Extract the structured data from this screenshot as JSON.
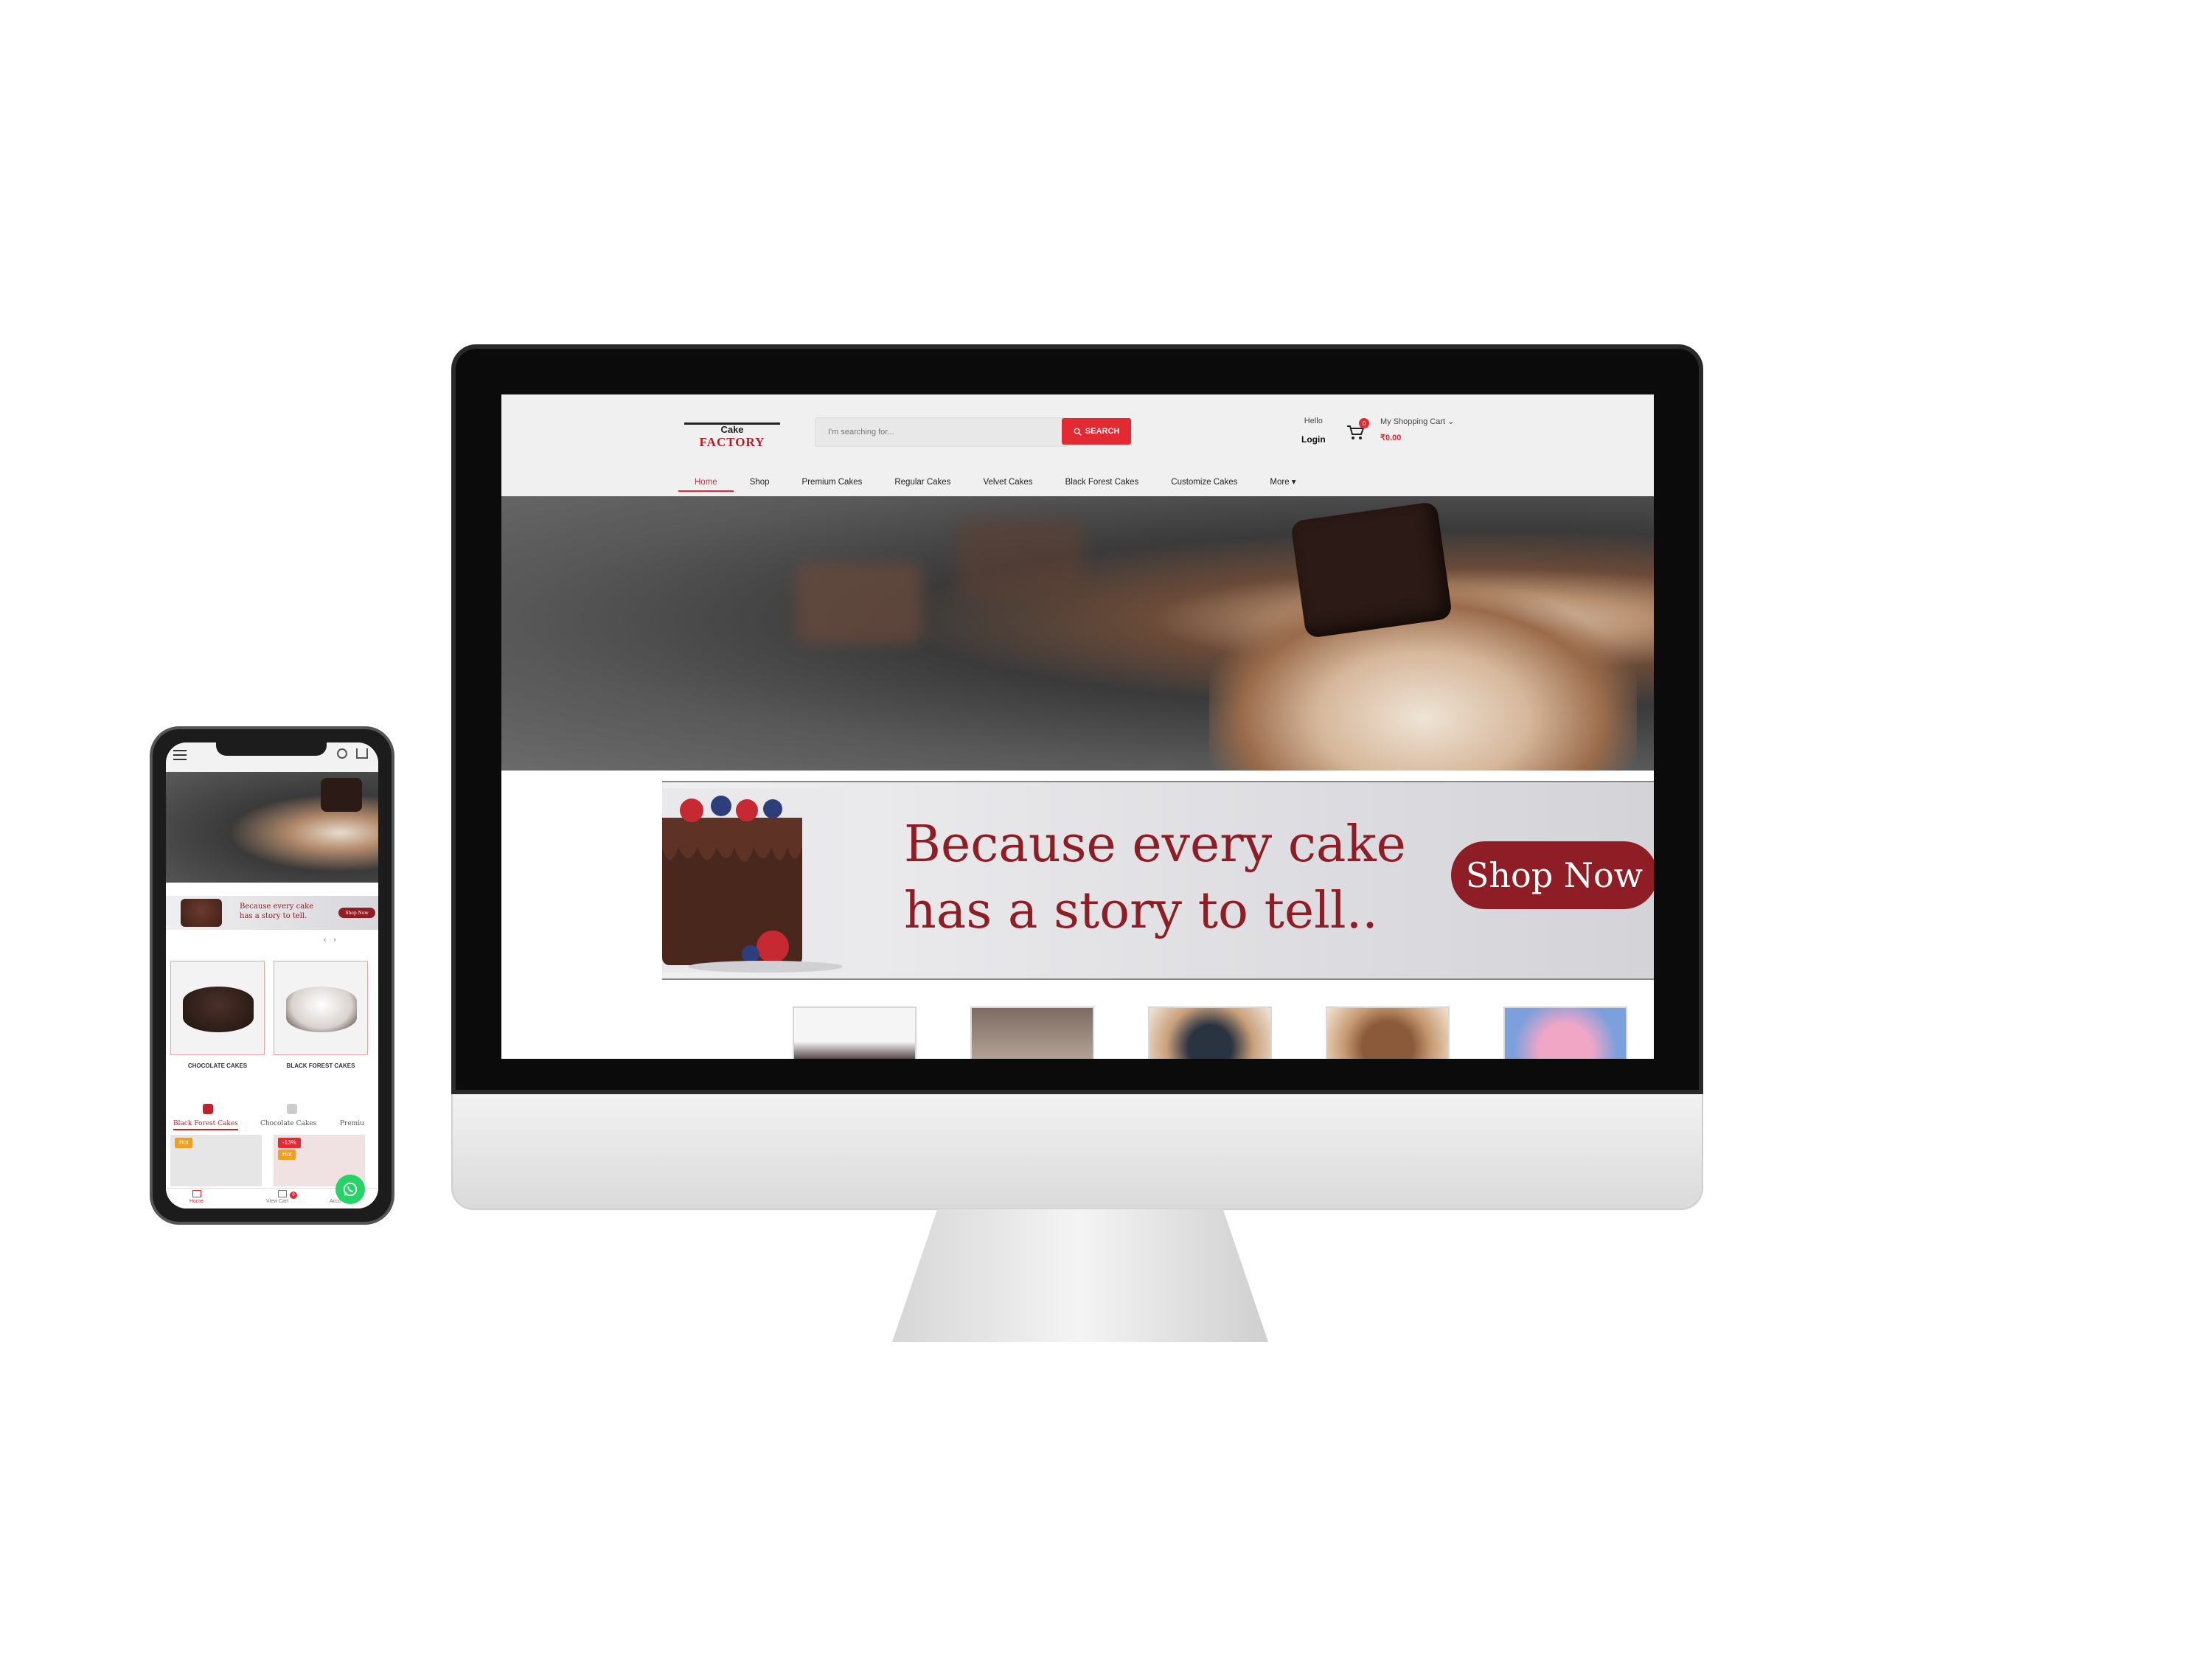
{
  "desktop": {
    "logo": {
      "top": "Cake",
      "bottom": "FACTORY"
    },
    "search": {
      "placeholder": "I'm searching for...",
      "button_label": "SEARCH"
    },
    "account": {
      "greeting": "Hello",
      "login_label": "Login"
    },
    "cart": {
      "count": "0",
      "label": "My Shopping Cart",
      "total": "₹0.00"
    },
    "nav": [
      "Home",
      "Shop",
      "Premium Cakes",
      "Regular Cakes",
      "Velvet Cakes",
      "Black Forest Cakes",
      "Customize Cakes",
      "More"
    ],
    "banner": {
      "tagline_line1": "Because every cake",
      "tagline_line2": "has a story to tell..",
      "cta": "Shop Now"
    }
  },
  "mobile": {
    "banner": {
      "tagline_line1": "Because every cake",
      "tagline_line2": "has a story to tell.",
      "cta": "Shop Now"
    },
    "categories": [
      {
        "label": "CHOCOLATE CAKES"
      },
      {
        "label": "BLACK FOREST CAKES"
      }
    ],
    "tabs": [
      "Black Forest Cakes",
      "Chocolate Cakes",
      "Premiu"
    ],
    "products": [
      {
        "badge": "Hot"
      },
      {
        "badge": "-13%",
        "badge2": "Hot"
      }
    ],
    "bottom_nav": {
      "home": "Home",
      "view_cart": "View Cart",
      "account": "Acco",
      "cart_count": "0"
    }
  },
  "colors": {
    "accent": "#e32a33",
    "maroon": "#8f1d25",
    "whatsapp": "#25d366"
  },
  "icons": [
    "menu-icon",
    "search-icon",
    "cart-icon",
    "chevron-down-icon",
    "home-icon",
    "whatsapp-icon"
  ]
}
